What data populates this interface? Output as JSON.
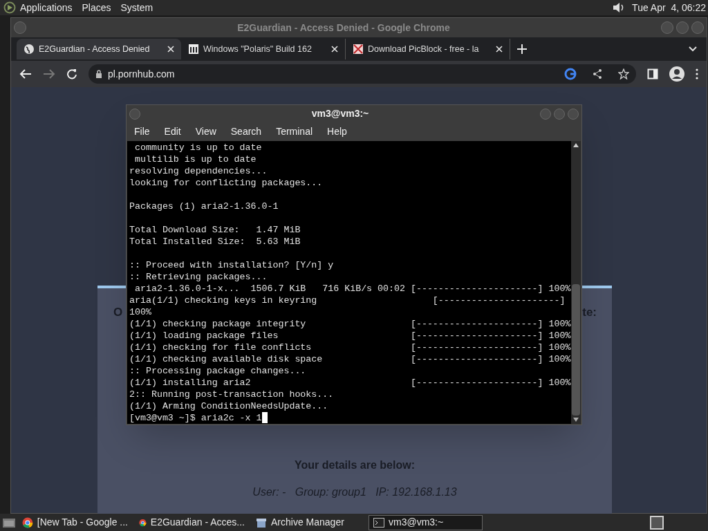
{
  "top_panel": {
    "menus": [
      "Applications",
      "Places",
      "System"
    ],
    "clock": "Tue Apr  4, 06:22"
  },
  "browser": {
    "title": "E2Guardian - Access Denied - Google Chrome",
    "tabs": [
      {
        "label": "E2Guardian - Access Denied",
        "selected": true
      },
      {
        "label": "Windows \"Polaris\" Build 162",
        "selected": false
      },
      {
        "label": "Download PicBlock - free - la",
        "selected": false
      }
    ],
    "address": "pl.pornhub.com",
    "page": {
      "heading_left": "O",
      "heading_right": "te:",
      "details_heading": "Your details are below:",
      "details": "User: -   Group: group1   IP: 192.168.1.13"
    }
  },
  "terminal": {
    "title": "vm3@vm3:~",
    "menus": [
      "File",
      "Edit",
      "View",
      "Search",
      "Terminal",
      "Help"
    ],
    "blocks": [
      [
        " community is up to date",
        " multilib is up to date",
        "resolving dependencies...",
        "looking for conflicting packages..."
      ],
      [
        "Packages (1) aria2-1.36.0-1"
      ],
      [
        "Total Download Size:   1.47 MiB",
        "Total Installed Size:  5.63 MiB"
      ],
      [
        ":: Proceed with installation? [Y/n] y",
        ":: Retrieving packages...",
        " aria2-1.36.0-1-x...  1506.7 KiB   716 KiB/s 00:02 [----------------------] 100%",
        "aria(1/1) checking keys in keyring                     [----------------------]",
        "100%",
        "(1/1) checking package integrity                   [----------------------] 100%",
        "(1/1) loading package files                        [----------------------] 100%",
        "(1/1) checking for file conflicts                  [----------------------] 100%",
        "(1/1) checking available disk space                [----------------------] 100%",
        ":: Processing package changes...",
        "(1/1) installing aria2                             [----------------------] 100%",
        "2:: Running post-transaction hooks...",
        "(1/1) Arming ConditionNeedsUpdate...",
        "[vm3@vm3 ~]$ aria2c -x 1"
      ]
    ]
  },
  "taskbar": [
    {
      "label": "[New Tab - Google ...",
      "kind": "chrome",
      "selected": false
    },
    {
      "label": "E2Guardian - Acces...",
      "kind": "chrome",
      "selected": false
    },
    {
      "label": "Archive Manager",
      "kind": "archive",
      "selected": false
    },
    {
      "label": "vm3@vm3:~",
      "kind": "terminal",
      "selected": true
    }
  ]
}
